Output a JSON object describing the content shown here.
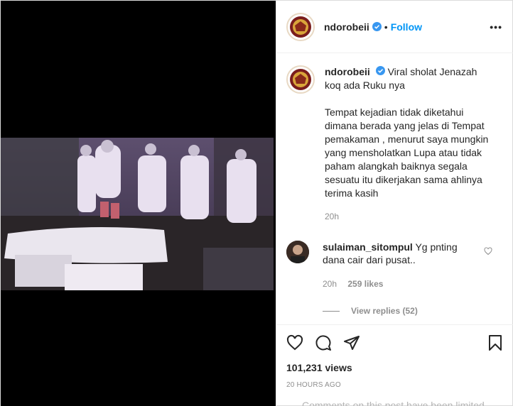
{
  "header": {
    "username": "ndorobeii",
    "separator": "•",
    "follow_label": "Follow",
    "more_label": "•••"
  },
  "caption": {
    "username": "ndorobeii",
    "text": "Viral sholat Jenazah koq ada Ruku nya\n\nTempat kejadian tidak diketahui dimana berada yang jelas di Tempat pemakaman , menurut saya mungkin yang mensholatkan Lupa atau tidak paham alangkah baiknya segala sesuatu itu dikerjakan sama ahlinya terima kasih",
    "time": "20h"
  },
  "comment": {
    "username": "sulaiman_sitompul",
    "text": "Yg pnting dana cair dari pusat..",
    "time": "20h",
    "likes": "259 likes",
    "view_replies": "View replies (52)"
  },
  "actions": {
    "views": "101,231 views",
    "posted": "20 HOURS AGO",
    "comments_limited": "Comments on this post have been limited."
  },
  "colors": {
    "accent": "#0095f6",
    "muted": "#8e8e8e",
    "text": "#262626"
  },
  "icons": [
    "verified-badge-icon",
    "heart-icon",
    "comment-icon",
    "share-icon",
    "bookmark-icon",
    "more-icon"
  ]
}
